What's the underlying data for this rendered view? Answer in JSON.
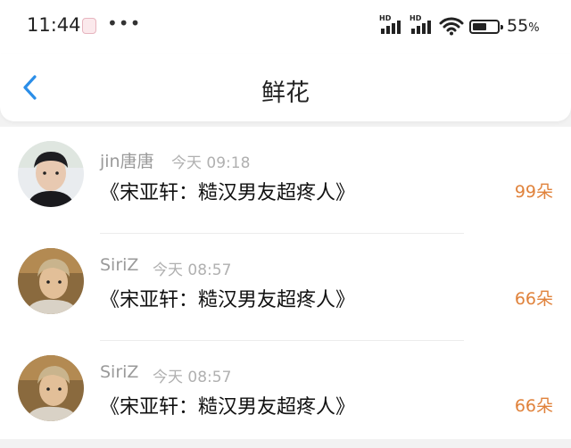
{
  "status_bar": {
    "time": "11:44",
    "dots": "•••",
    "hd1": "HD",
    "hd2": "HD",
    "battery_percent": "55",
    "battery_percent_sign": "%"
  },
  "header": {
    "title": "鲜花",
    "back_icon": "chevron-left-icon",
    "accent_color": "#2b8ee8"
  },
  "items": [
    {
      "username": "jin唐唐",
      "timestamp": "今天 09:18",
      "message": "《宋亚轩：糙汉男友超疼人》",
      "flowers": "99朵"
    },
    {
      "username": "SiriZ",
      "timestamp": "今天 08:57",
      "message": "《宋亚轩：糙汉男友超疼人》",
      "flowers": "66朵"
    },
    {
      "username": "SiriZ",
      "timestamp": "今天 08:57",
      "message": "《宋亚轩：糙汉男友超疼人》",
      "flowers": "66朵"
    }
  ],
  "colors": {
    "flower_count": "#e0823b",
    "username": "#9a9a9a",
    "timestamp": "#b0b0b0"
  }
}
